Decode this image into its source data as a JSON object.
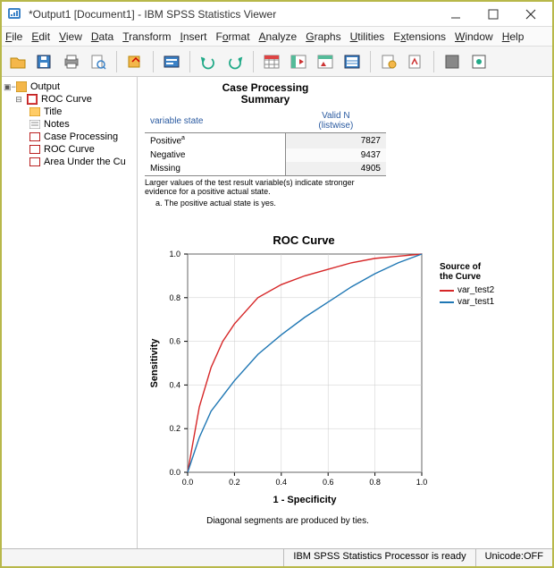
{
  "window": {
    "title": "*Output1 [Document1] - IBM SPSS Statistics Viewer"
  },
  "menu": {
    "items": [
      "File",
      "Edit",
      "View",
      "Data",
      "Transform",
      "Insert",
      "Format",
      "Analyze",
      "Graphs",
      "Utilities",
      "Extensions",
      "Window",
      "Help"
    ]
  },
  "nav": {
    "root": "Output",
    "group": "ROC Curve",
    "children": [
      "Title",
      "Notes",
      "Case Processing",
      "ROC Curve",
      "Area Under the Cu"
    ]
  },
  "cps": {
    "title1": "Case Processing",
    "title2": "Summary",
    "col1": "variable state",
    "col2a": "Valid N",
    "col2b": "(listwise)",
    "rows": [
      {
        "label": "Positive",
        "sup": "a",
        "value": "7827"
      },
      {
        "label": "Negative",
        "sup": "",
        "value": "9437"
      },
      {
        "label": "Missing",
        "sup": "",
        "value": "4905"
      }
    ],
    "caption": "Larger values of the test result variable(s) indicate stronger evidence for a positive actual state.",
    "footnote": "a. The positive actual state is yes."
  },
  "chart_data": {
    "type": "line",
    "title": "ROC Curve",
    "xlabel": "1 - Specificity",
    "ylabel": "Sensitivity",
    "xlim": [
      0.0,
      1.0
    ],
    "ylim": [
      0.0,
      1.0
    ],
    "xticks": [
      "0.0",
      "0.2",
      "0.4",
      "0.6",
      "0.8",
      "1.0"
    ],
    "yticks": [
      "0.0",
      "0.2",
      "0.4",
      "0.6",
      "0.8",
      "1.0"
    ],
    "legend_title": "Source of the Curve",
    "series": [
      {
        "name": "var_test2",
        "color": "#d62728",
        "x": [
          0.0,
          0.05,
          0.1,
          0.15,
          0.2,
          0.3,
          0.4,
          0.5,
          0.6,
          0.7,
          0.8,
          0.9,
          1.0
        ],
        "y": [
          0.0,
          0.3,
          0.48,
          0.6,
          0.68,
          0.8,
          0.86,
          0.9,
          0.93,
          0.96,
          0.98,
          0.99,
          1.0
        ]
      },
      {
        "name": "var_test1",
        "color": "#1f77b4",
        "x": [
          0.0,
          0.05,
          0.1,
          0.2,
          0.3,
          0.4,
          0.5,
          0.6,
          0.7,
          0.8,
          0.9,
          1.0
        ],
        "y": [
          0.0,
          0.16,
          0.28,
          0.42,
          0.54,
          0.63,
          0.71,
          0.78,
          0.85,
          0.91,
          0.96,
          1.0
        ]
      }
    ],
    "footnote": "Diagonal segments are produced by ties."
  },
  "status": {
    "processor": "IBM SPSS Statistics Processor is ready",
    "unicode": "Unicode:OFF"
  },
  "colors": {
    "series1": "#d62728",
    "series2": "#1f77b4"
  }
}
